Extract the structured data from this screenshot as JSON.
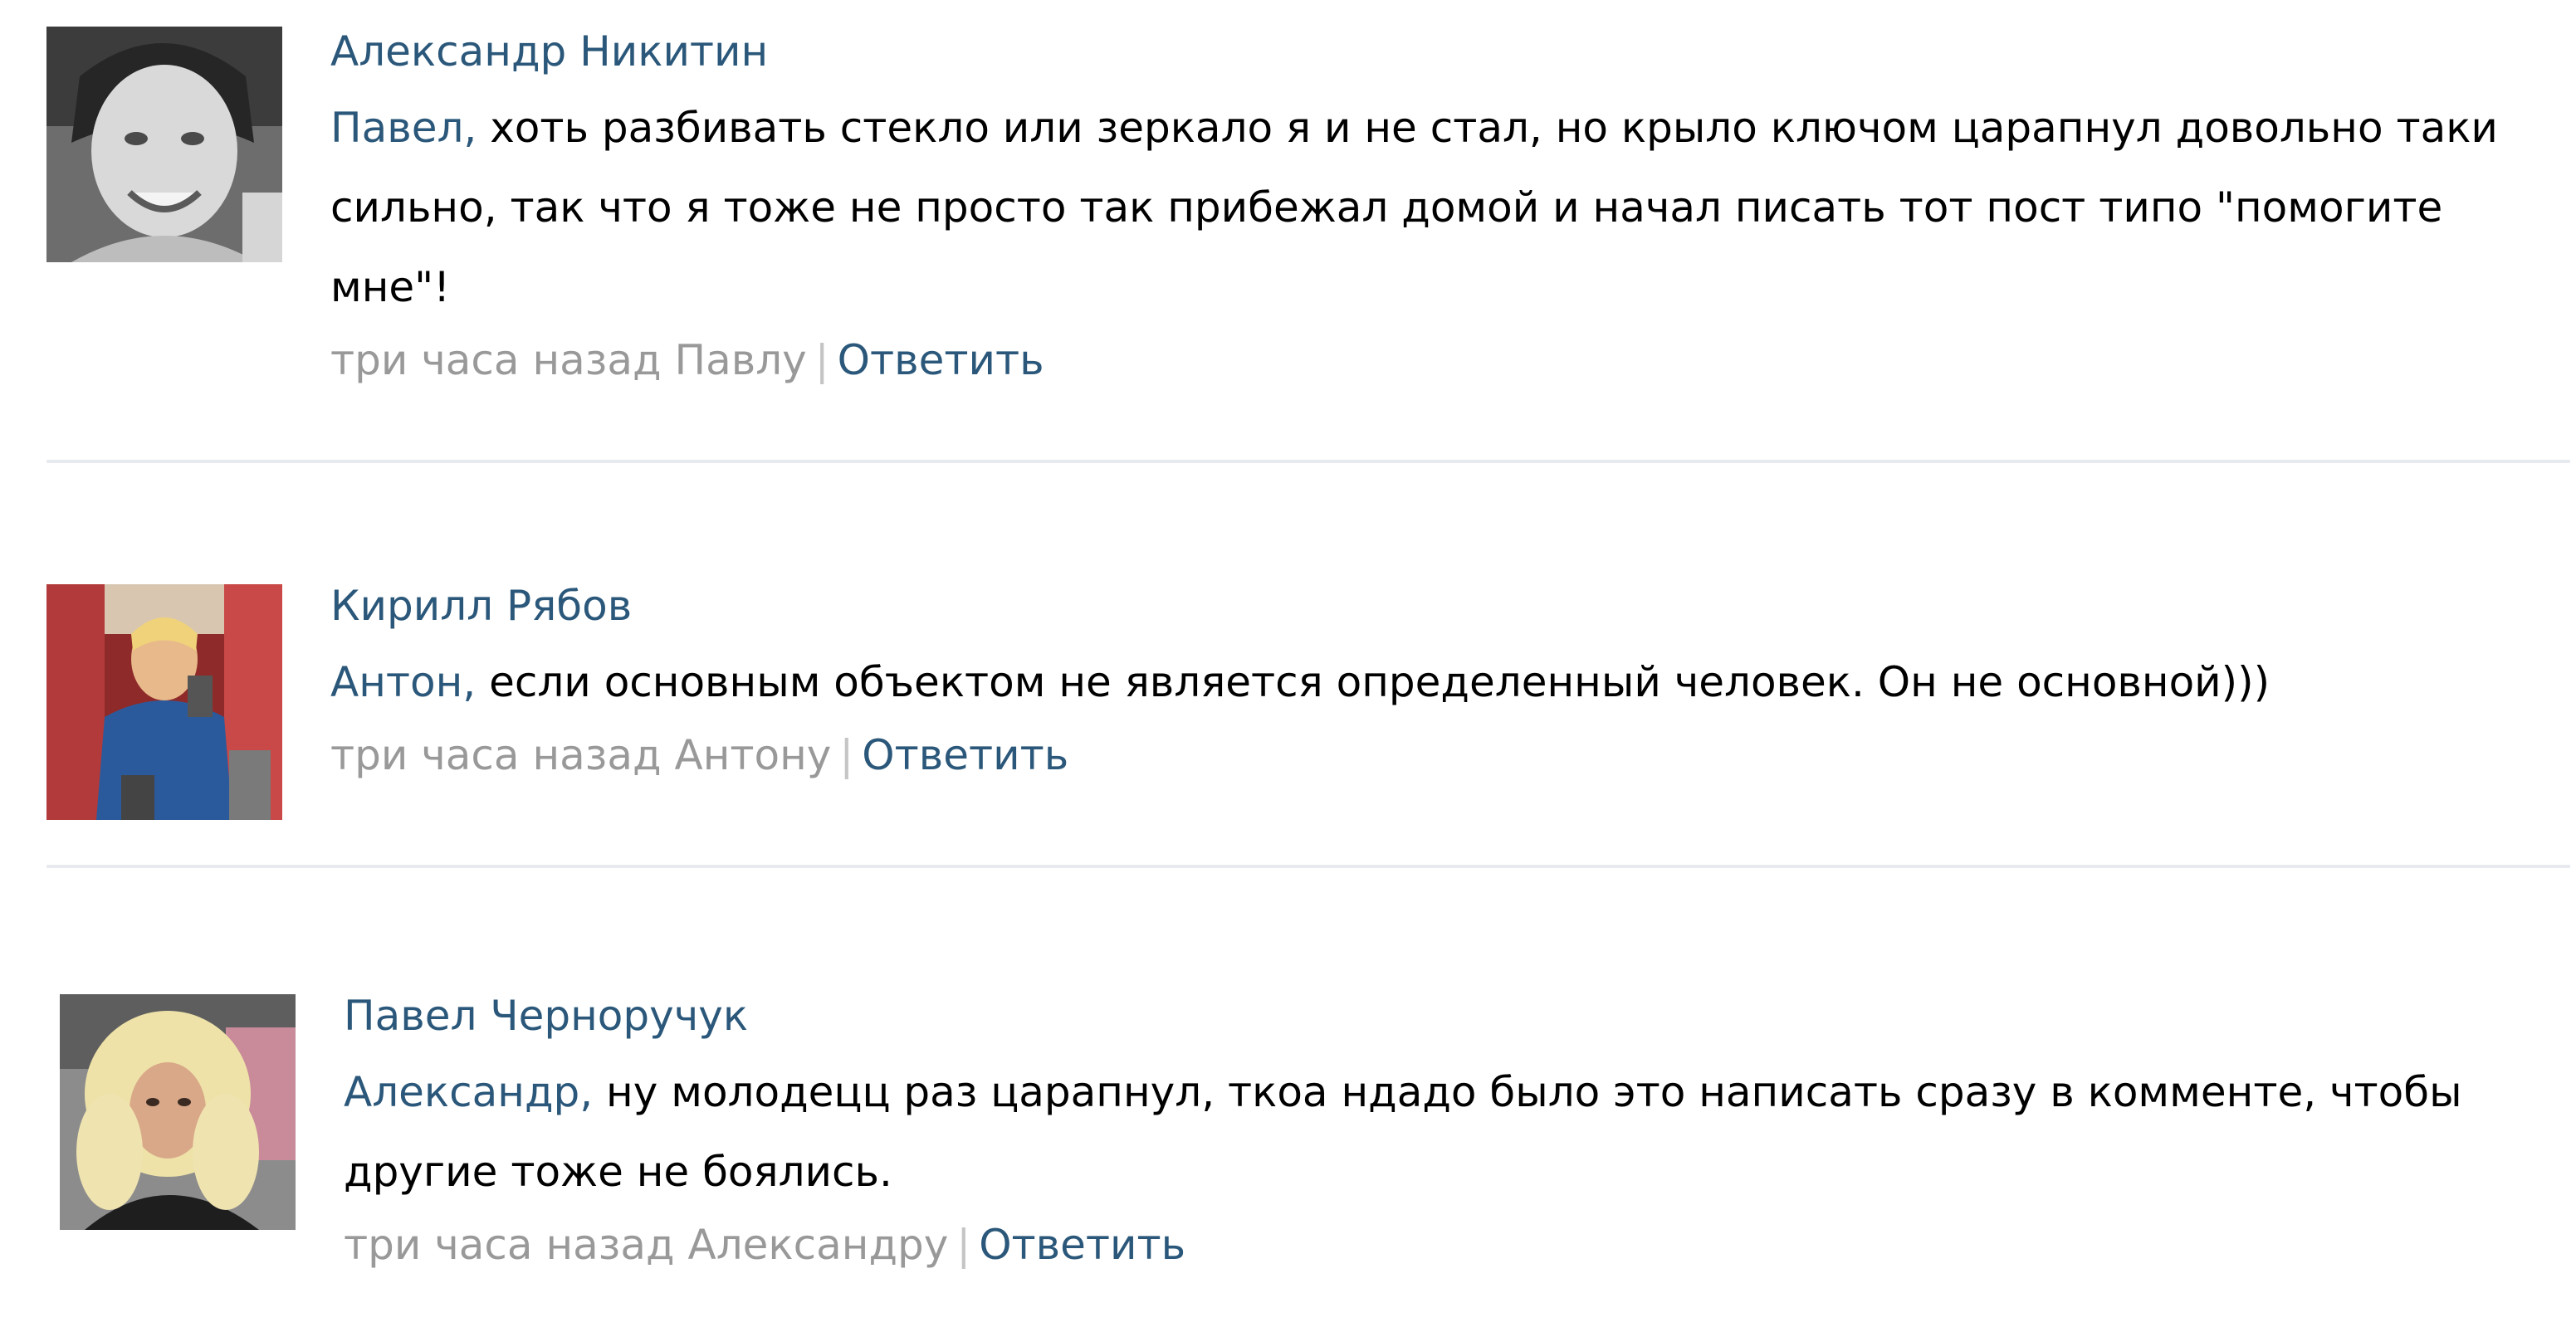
{
  "comments": [
    {
      "author": "Александр Никитин",
      "addressee": "Павел,",
      "text": " хоть разбивать стекло или зеркало я и не стал, но крыло ключом царапнул довольно таки сильно, так что я тоже не просто так прибежал домой и начал писать тот пост типо \"помогите мне\"!",
      "time": "три часа назад",
      "reply_to": "Павлу",
      "separator": "|",
      "reply_label": "Ответить",
      "avatar_icon": "user-photo-avatar"
    },
    {
      "author": "Кирилл Рябов",
      "addressee": "Антон,",
      "text": " если основным объектом не является определенный человек. Он не основной)))",
      "time": "три часа назад",
      "reply_to": "Антону",
      "separator": "|",
      "reply_label": "Ответить",
      "avatar_icon": "user-photo-avatar"
    },
    {
      "author": "Павел Черноручук",
      "addressee": "Александр,",
      "text": " ну молодецц раз царапнул, ткоа ндадо было это написать сразу в комменте, чтобы другие тоже не боялись.",
      "time": "три часа назад",
      "reply_to": "Александру",
      "separator": "|",
      "reply_label": "Ответить",
      "avatar_icon": "user-photo-avatar"
    }
  ],
  "colors": {
    "link": "#2b587a",
    "meta": "#999999",
    "divider": "#e7ebf0",
    "text": "#000000"
  }
}
